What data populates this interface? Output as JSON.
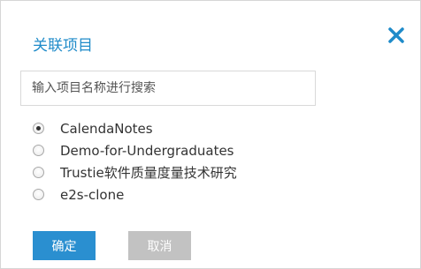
{
  "dialog": {
    "title": "关联项目",
    "close_icon": "close-icon",
    "search": {
      "placeholder": "输入项目名称进行搜索",
      "value": ""
    },
    "projects": [
      {
        "label": "CalendaNotes",
        "checked": true
      },
      {
        "label": "Demo-for-Undergraduates",
        "checked": false
      },
      {
        "label": "Trustie软件质量度量技术研究",
        "checked": false
      },
      {
        "label": "e2s-clone",
        "checked": false
      }
    ],
    "confirm_label": "确定",
    "cancel_label": "取消"
  },
  "colors": {
    "accent": "#1f8bc9",
    "confirm_button": "#2a8fd0",
    "cancel_button": "#c2c2c2"
  }
}
